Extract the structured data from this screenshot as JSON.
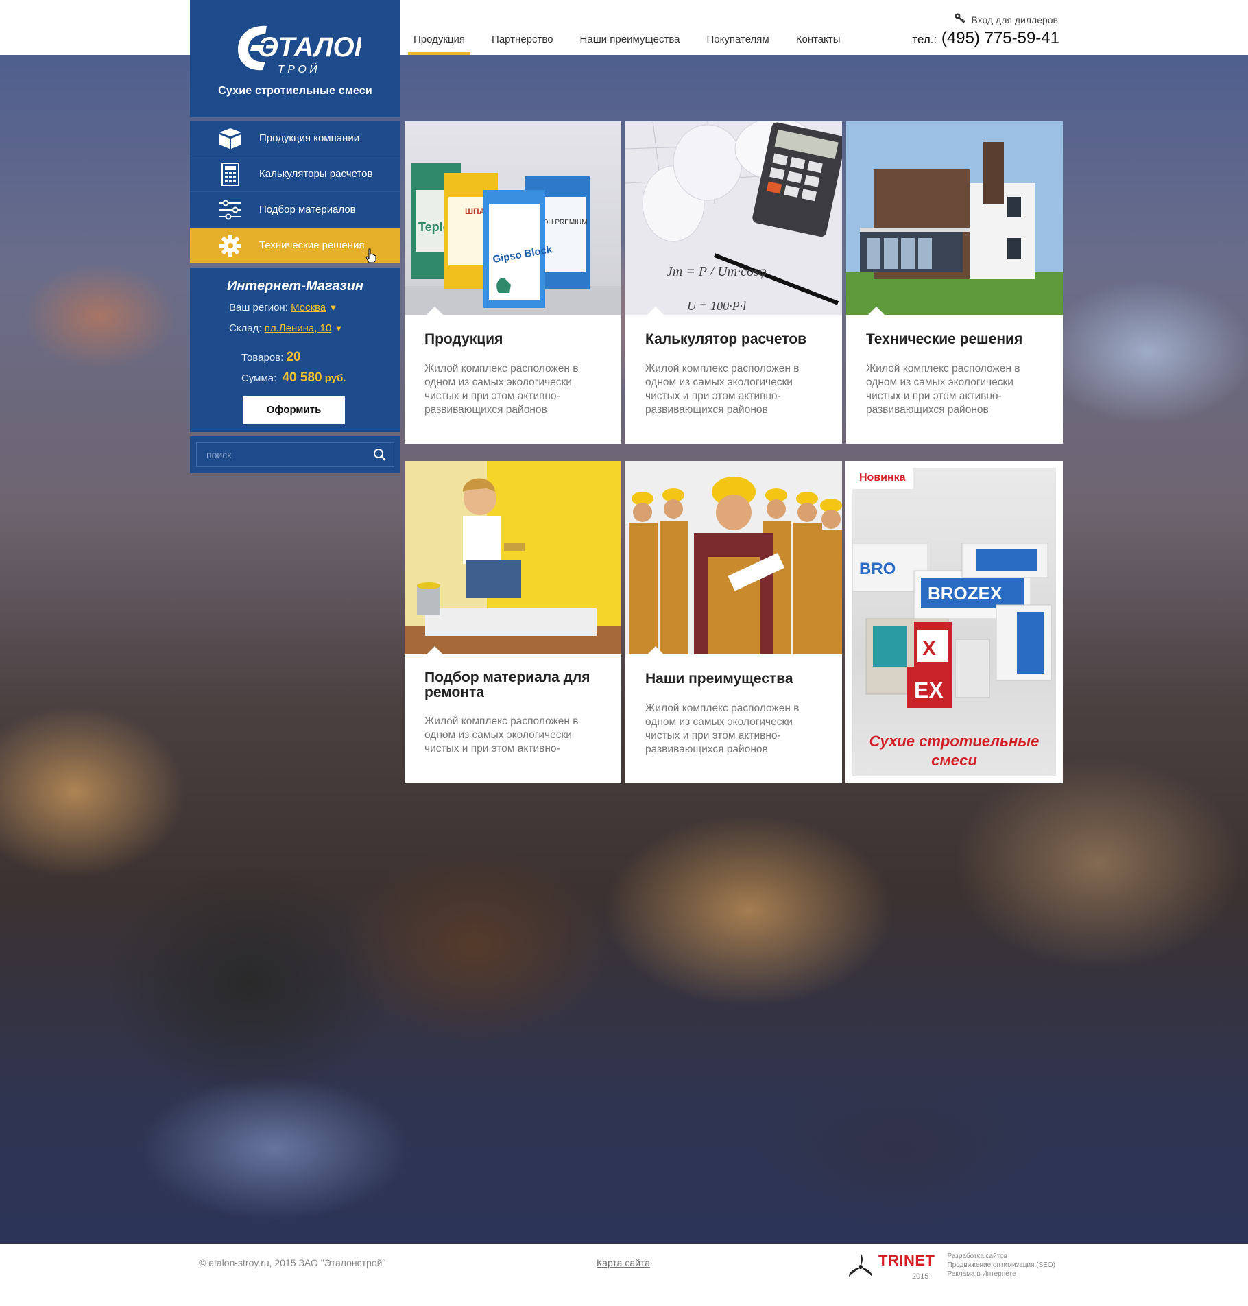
{
  "brand": {
    "logo_main": "ЭТАЛОН",
    "logo_sub": "Т Р О Й",
    "tagline": "Сухие стротиельные смеси",
    "color_primary": "#1d4b8c",
    "color_accent": "#e6b02b"
  },
  "nav": {
    "items": [
      "Продукция",
      "Партнерство",
      "Наши преимущества",
      "Покупателям",
      "Контакты"
    ],
    "active": 0
  },
  "header": {
    "dealer_login": "Вход для диллеров",
    "phone_prefix": "тел.:",
    "phone": "(495) 775-59-41"
  },
  "sidebar": {
    "items": [
      {
        "label": "Продукция компании",
        "icon": "box-icon"
      },
      {
        "label": "Калькуляторы расчетов",
        "icon": "calculator-icon"
      },
      {
        "label": "Подбор материалов",
        "icon": "sliders-icon"
      },
      {
        "label": "Технические решения",
        "icon": "gear-icon"
      }
    ],
    "active": 3
  },
  "shop": {
    "title": "Интернет-Магазин",
    "region_label": "Ваш регион:",
    "region_value": "Москва",
    "warehouse_label": "Склад:",
    "warehouse_value": "пл.Ленина, 10",
    "items_label": "Товаров:",
    "items_count": "20",
    "sum_label": "Сумма:",
    "sum_value": "40 580",
    "sum_currency": "руб.",
    "order_button": "Оформить",
    "arrow": "▼"
  },
  "search": {
    "placeholder": "поиск"
  },
  "cards": [
    {
      "title": "Продукция",
      "text": "Жилой комплекс расположен в одном из самых экологически чистых и при этом активно-развивающихся районов"
    },
    {
      "title": "Калькулятор расчетов",
      "text": "Жилой комплекс расположен в одном из самых экологически чистых и при этом активно-развивающихся районов"
    },
    {
      "title": "Технические решения",
      "text": "Жилой комплекс расположен в одном из самых экологически чистых и при этом активно-развивающихся районов"
    },
    {
      "title": "Подбор материала для ремонта",
      "text": "Жилой комплекс расположен в одном из самых экологически чистых и при этом активно-"
    },
    {
      "title": "Наши преимущества",
      "text": "Жилой комплекс расположен в одном из самых экологически чистых и при этом активно-развивающихся районов"
    }
  ],
  "promo": {
    "badge": "Новинка",
    "text": "Сухие стротиельные смеси",
    "brand": "BROZEX"
  },
  "footer": {
    "copyright": "© etalon-stroy.ru, 2015 ЗАО \"Эталонстрой\"",
    "sitemap": "Карта сайта",
    "dev_name": "TRINET",
    "dev_year": "2015",
    "dev_lines": [
      "Разработка сайтов",
      "Продвижение оптимизация (SEO)",
      "Реклама в Интернете"
    ]
  }
}
